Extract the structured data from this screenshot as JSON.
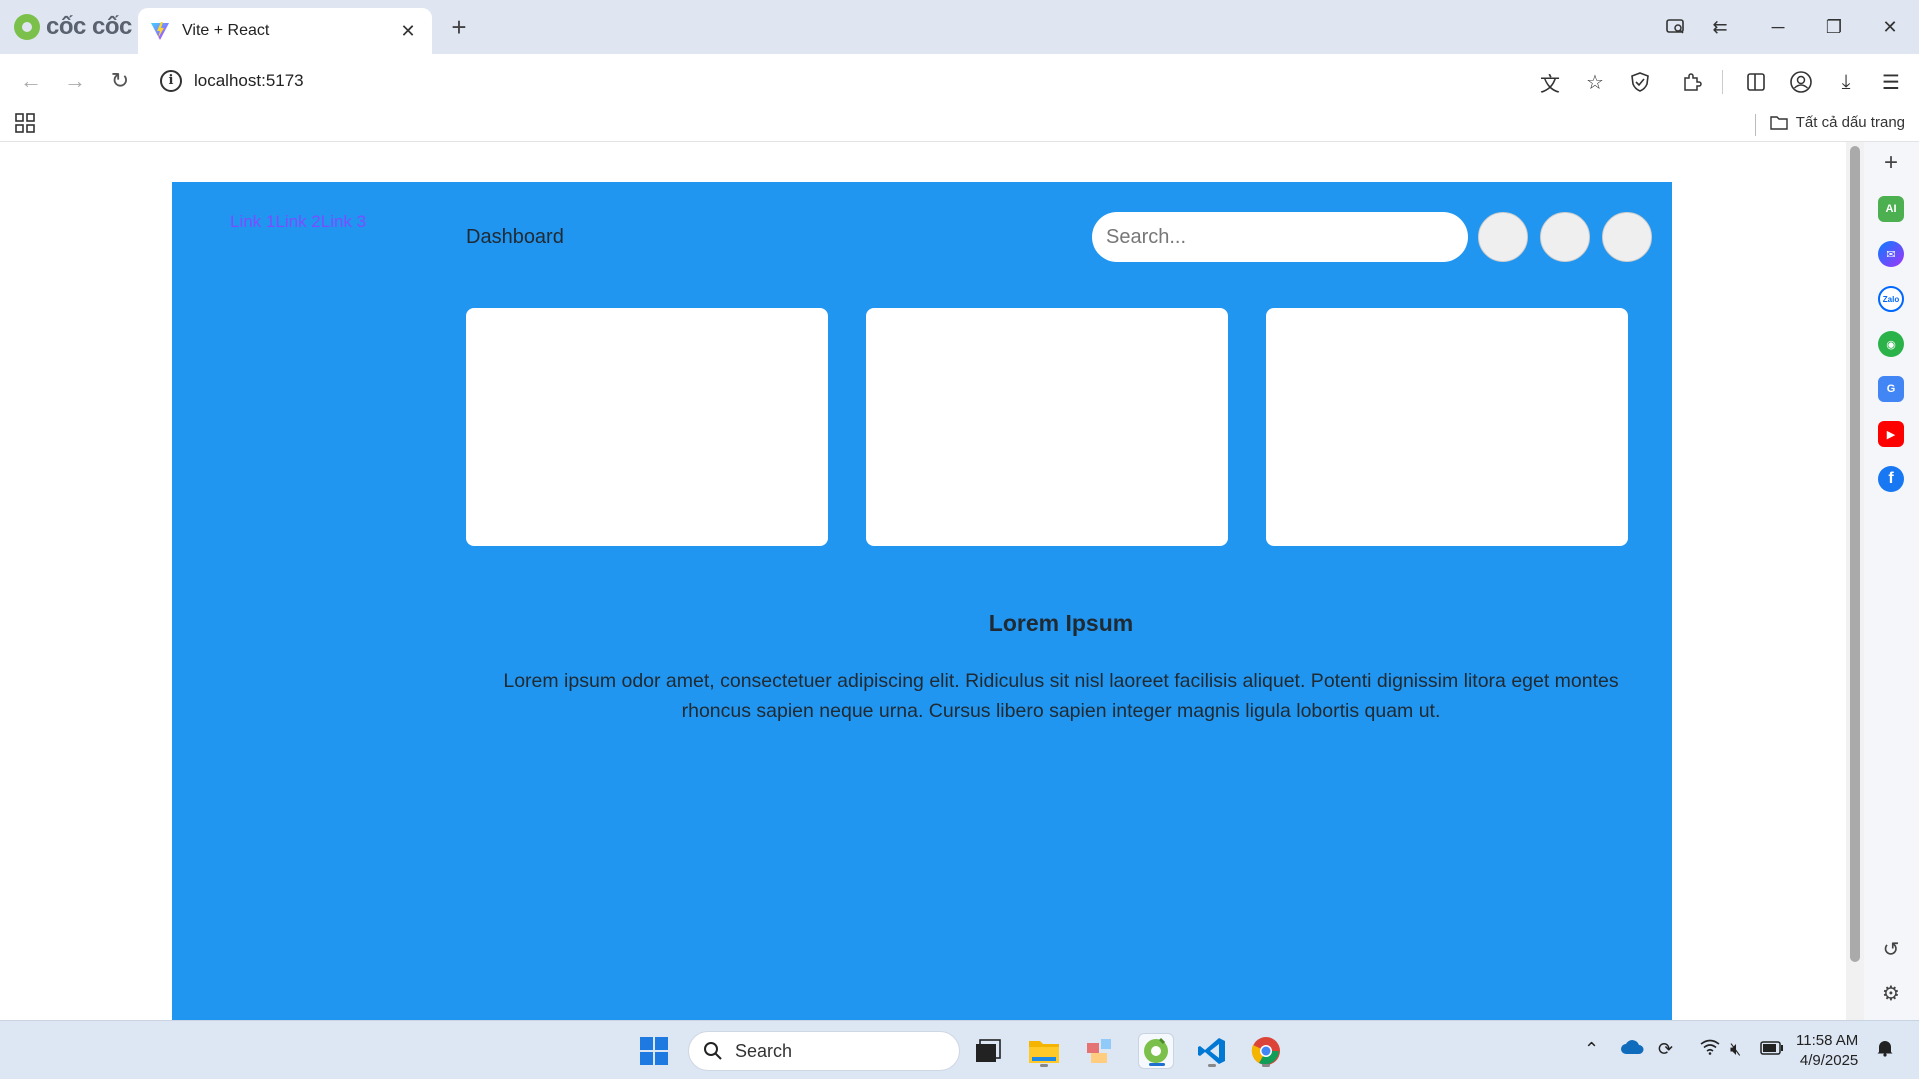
{
  "browser": {
    "brand": "cốc cốc",
    "tab_title": "Vite + React",
    "url": "localhost:5173",
    "bookmarks_all": "Tất cả dấu trang"
  },
  "page": {
    "nav_links": [
      "Link 1",
      "Link 2",
      "Link 3"
    ],
    "header_title": "Dashboard",
    "search_placeholder": "Search...",
    "section_title": "Lorem Ipsum",
    "section_text": "Lorem ipsum odor amet, consectetuer adipiscing elit. Ridiculus sit nisl laoreet facilisis aliquet. Potenti dignissim litora eget montes rhoncus sapien neque urna. Cursus libero sapien integer magnis ligula lobortis quam ut."
  },
  "taskbar": {
    "search_label": "Search",
    "time": "11:58 AM",
    "date": "4/9/2025"
  },
  "colors": {
    "app_background": "#2196f0",
    "nav_link": "#7d4cff",
    "card": "#ffffff"
  }
}
